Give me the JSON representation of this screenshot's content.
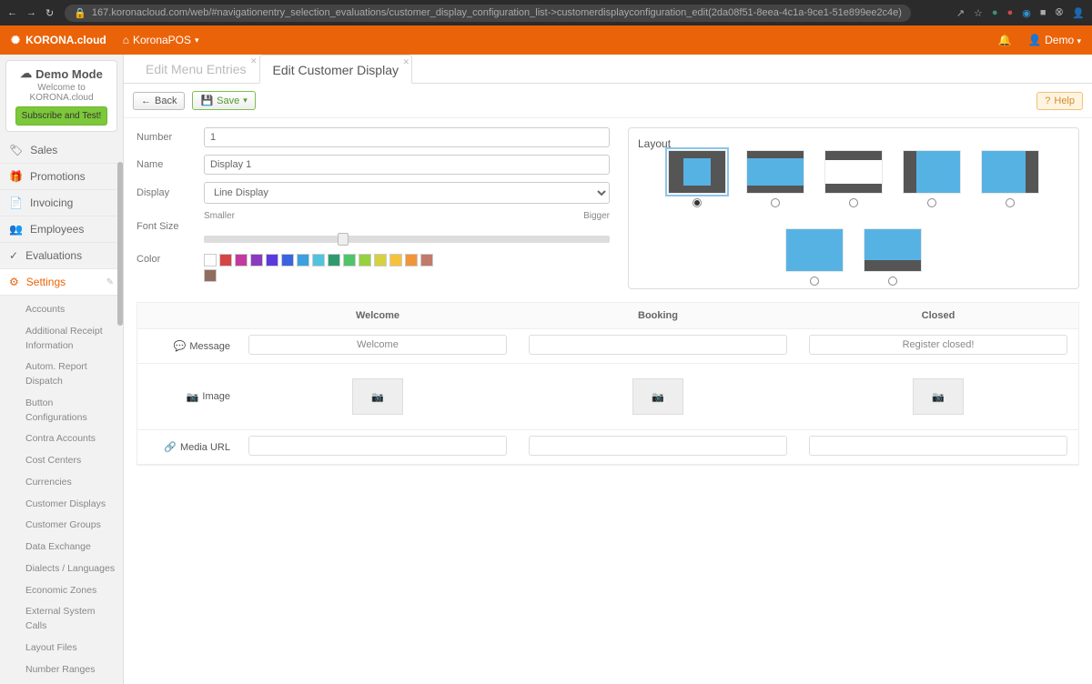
{
  "browser": {
    "url": "167.koronacloud.com/web/#navigationentry_selection_evaluations/customer_display_configuration_list->customerdisplayconfiguration_edit(2da08f51-8eea-4c1a-9ce1-51e899ee2c4e)"
  },
  "topbar": {
    "brand": "KORONA.cloud",
    "home": "KoronaPOS",
    "user": "Demo"
  },
  "demo": {
    "title": "Demo Mode",
    "welcome": "Welcome to KORONA.cloud",
    "button": "Subscribe and Test!"
  },
  "nav": {
    "items": [
      {
        "icon": "tag",
        "label": "Sales"
      },
      {
        "icon": "gift",
        "label": "Promotions"
      },
      {
        "icon": "file",
        "label": "Invoicing"
      },
      {
        "icon": "users",
        "label": "Employees"
      },
      {
        "icon": "check",
        "label": "Evaluations"
      },
      {
        "icon": "gear",
        "label": "Settings"
      }
    ],
    "sub": [
      "Accounts",
      "Additional Receipt Information",
      "Autom. Report Dispatch",
      "Button Configurations",
      "Contra Accounts",
      "Cost Centers",
      "Currencies",
      "Customer Displays",
      "Customer Groups",
      "Data Exchange",
      "Dialects / Languages",
      "Economic Zones",
      "External System Calls",
      "Layout Files",
      "Number Ranges"
    ]
  },
  "tabs": [
    {
      "label": "Edit Menu Entries",
      "active": false
    },
    {
      "label": "Edit Customer Display",
      "active": true
    }
  ],
  "toolbar": {
    "back": "Back",
    "save": "Save",
    "help": "Help"
  },
  "form": {
    "number_label": "Number",
    "number_value": "1",
    "name_label": "Name",
    "name_value": "Display 1",
    "display_label": "Display",
    "display_value": "Line Display",
    "font_label": "Font Size",
    "smaller": "Smaller",
    "bigger": "Bigger",
    "color_label": "Color",
    "colors_row1": [
      "#ffffff",
      "#d64545",
      "#c23aa0",
      "#8a3abf",
      "#5a3ae0",
      "#3a63e0",
      "#3aa0e0",
      "#52c3dd"
    ],
    "colors_row2": [
      "#2e9b6e",
      "#4fc467",
      "#96d13e",
      "#d6d13e",
      "#f5c23a",
      "#f0953a",
      "#c1796a",
      "#8f6e60"
    ],
    "layout_label": "Layout"
  },
  "columns": {
    "welcome": "Welcome",
    "booking": "Booking",
    "closed": "Closed"
  },
  "rows": {
    "message": "Message",
    "image": "Image",
    "media": "Media URL"
  },
  "messages": {
    "welcome": "Welcome",
    "booking": "",
    "closed": "Register closed!"
  }
}
